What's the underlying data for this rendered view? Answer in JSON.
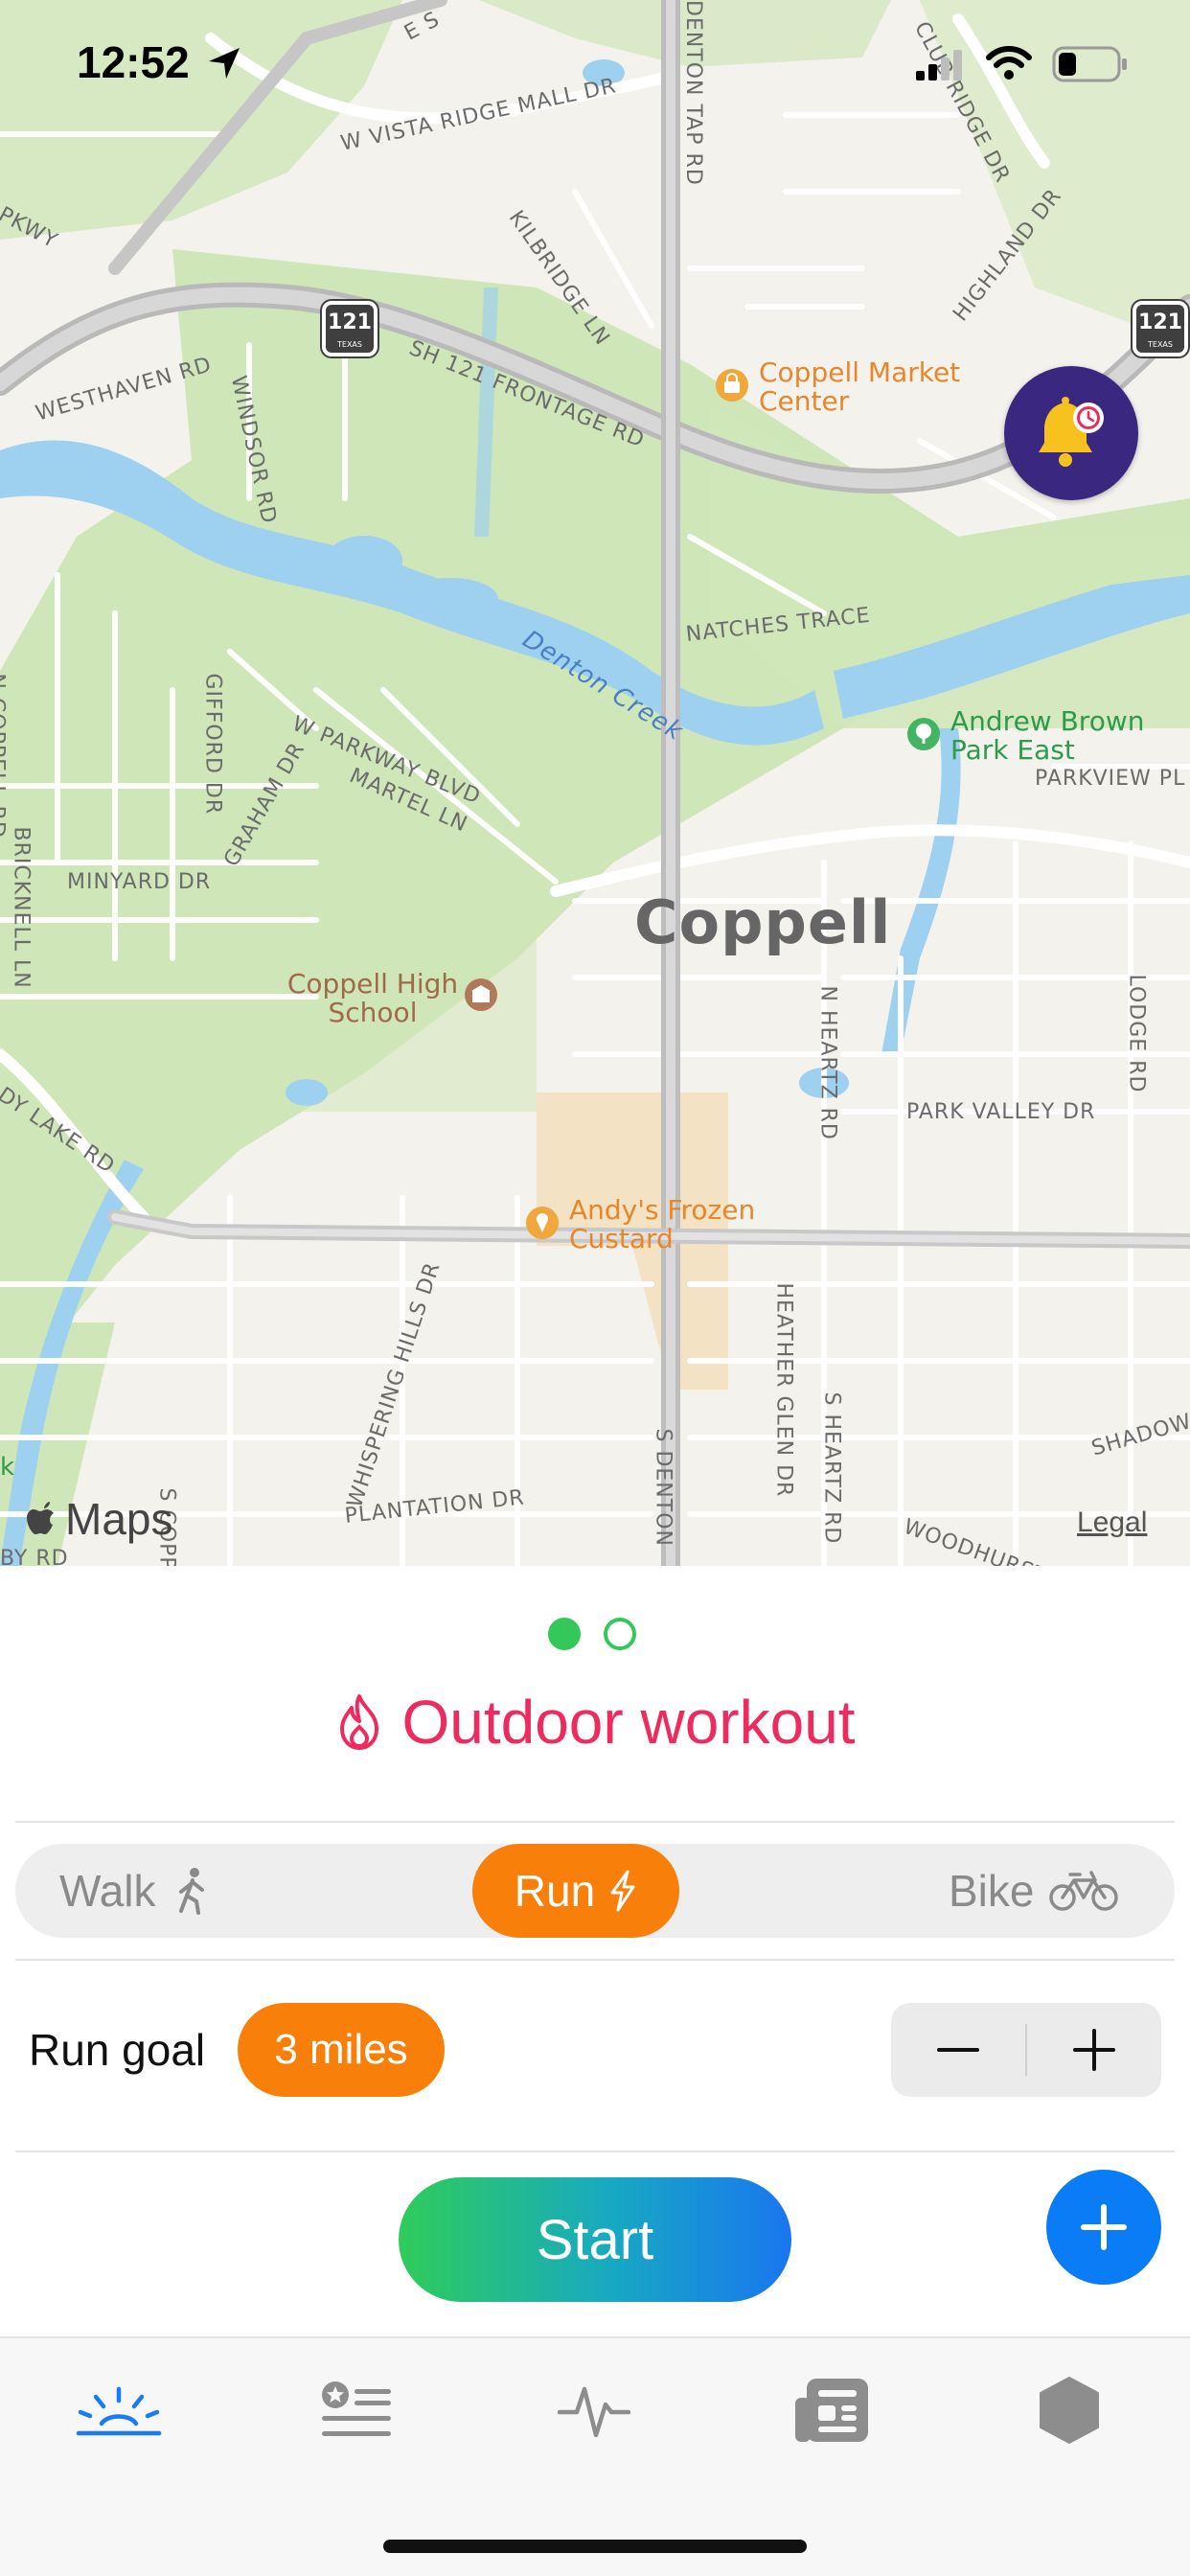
{
  "status_bar": {
    "time": "12:52"
  },
  "map": {
    "city": "Coppell",
    "roads": [
      "W VISTA RIDGE MALL DR",
      "DENTON TAP RD",
      "CLUB RIDGE DR",
      "KILBRIDGE LN",
      "HIGHLAND DR",
      "SH 121 FRONTAGE RD",
      "WESTHAVEN RD",
      "WINDSOR RD",
      "NATCHES TRACE",
      "W PARKWAY BLVD",
      "MARTEL LN",
      "GIFFORD DR",
      "GRAHAM DR",
      "MINYARD DR",
      "N COPPELL RD",
      "BRICKNELL LN",
      "PARKVIEW PL",
      "N HEARTZ RD",
      "LODGE RD",
      "PARK VALLEY DR",
      "DY LAKE RD",
      "HEATHER GLEN DR",
      "S HEARTZ RD",
      "S DENTON",
      "SHADOW",
      "WOODHURST DR",
      "WHISPERING HILLS DR",
      "PLANTATION DR",
      "S COPP",
      "PKWY",
      "E S",
      "BY RD"
    ],
    "creek": "Denton Creek",
    "highway_shield": "121",
    "highway_state": "TEXAS",
    "pois": {
      "market": "Coppell Market Center",
      "park": "Andrew Brown Park East",
      "school": "Coppell High School",
      "custard": "Andy's Frozen Custard"
    },
    "attribution": "Maps",
    "legal": "Legal",
    "edge_k": "k"
  },
  "workout": {
    "title": "Outdoor workout",
    "modes": {
      "walk": "Walk",
      "run": "Run",
      "bike": "Bike"
    },
    "selected_mode": "Run",
    "goal_label": "Run goal",
    "goal_value": "3 miles",
    "start_label": "Start"
  },
  "pager": {
    "count": 2,
    "current": 1
  },
  "colors": {
    "accent_orange": "#f97f0b",
    "title_pink": "#ee2b5f",
    "pager_green": "#34c759",
    "fab_blue": "#0a7cf5",
    "tab_active": "#1a7cf0"
  },
  "tabs": [
    {
      "icon": "sunrise-icon",
      "active": true
    },
    {
      "icon": "star-list-icon",
      "active": false
    },
    {
      "icon": "heartbeat-icon",
      "active": false
    },
    {
      "icon": "newspaper-icon",
      "active": false
    },
    {
      "icon": "hexagon-icon",
      "active": false
    }
  ]
}
